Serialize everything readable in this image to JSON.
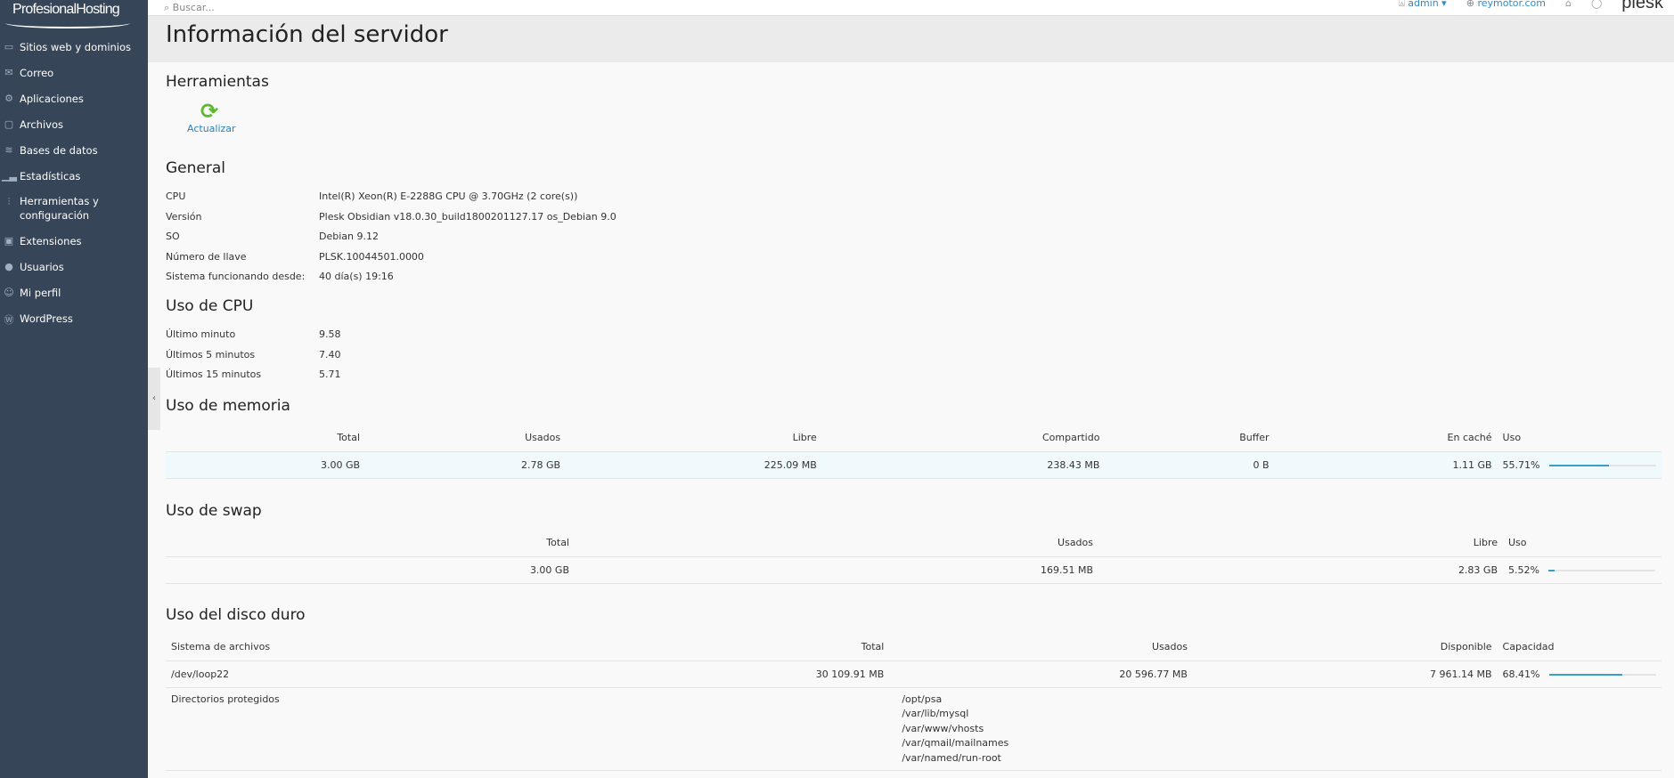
{
  "brand": "ProfesionalHosting",
  "sidebar": {
    "items": [
      {
        "label": "Sitios web y dominios",
        "icon": "monitor-icon"
      },
      {
        "label": "Correo",
        "icon": "mail-icon"
      },
      {
        "label": "Aplicaciones",
        "icon": "gear-icon"
      },
      {
        "label": "Archivos",
        "icon": "folder-icon"
      },
      {
        "label": "Bases de datos",
        "icon": "database-icon"
      },
      {
        "label": "Estadísticas",
        "icon": "bar-chart-icon"
      },
      {
        "label": "Herramientas y configuración",
        "icon": "sliders-icon"
      },
      {
        "label": "Extensiones",
        "icon": "extensions-icon"
      },
      {
        "label": "Usuarios",
        "icon": "user-icon"
      },
      {
        "label": "Mi perfil",
        "icon": "profile-icon"
      },
      {
        "label": "WordPress",
        "icon": "wordpress-icon"
      }
    ]
  },
  "topbar": {
    "search_placeholder": "Buscar...",
    "user": "admin",
    "subscription": "reymotor.com",
    "logo": "plesk"
  },
  "page_title": "Información del servidor",
  "tools": {
    "heading": "Herramientas",
    "refresh_label": "Actualizar"
  },
  "general": {
    "heading": "General",
    "rows": [
      {
        "k": "CPU",
        "v": "Intel(R) Xeon(R) E-2288G CPU @ 3.70GHz (2 core(s))"
      },
      {
        "k": "Versión",
        "v": "Plesk Obsidian v18.0.30_build1800201127.17 os_Debian 9.0"
      },
      {
        "k": "SO",
        "v": "Debian 9.12"
      },
      {
        "k": "Número de llave",
        "v": "PLSK.10044501.0000"
      },
      {
        "k": "Sistema funcionando desde:",
        "v": "40 día(s) 19:16"
      }
    ]
  },
  "cpu": {
    "heading": "Uso de CPU",
    "rows": [
      {
        "k": "Último minuto",
        "v": "9.58"
      },
      {
        "k": "Últimos 5 minutos",
        "v": "7.40"
      },
      {
        "k": "Últimos 15 minutos",
        "v": "5.71"
      }
    ]
  },
  "memory": {
    "heading": "Uso de memoria",
    "headers": [
      "Total",
      "Usados",
      "Libre",
      "Compartido",
      "Buffer",
      "En caché",
      "Uso"
    ],
    "values": [
      "3.00 GB",
      "2.78 GB",
      "225.09 MB",
      "238.43 MB",
      "0 B",
      "1.11 GB",
      "55.71%"
    ],
    "usage_percent": 55.71
  },
  "swap": {
    "heading": "Uso de swap",
    "headers": [
      "Total",
      "Usados",
      "Libre",
      "Uso"
    ],
    "values": [
      "3.00 GB",
      "169.51 MB",
      "2.83 GB",
      "5.52%"
    ],
    "usage_percent": 5.52
  },
  "disk": {
    "heading": "Uso del disco duro",
    "headers": [
      "Sistema de archivos",
      "Total",
      "Usados",
      "Disponible",
      "Capacidad"
    ],
    "values": [
      "/dev/loop22",
      "30 109.91 MB",
      "20 596.77 MB",
      "7 961.14 MB",
      "68.41%"
    ],
    "usage_percent": 68.41,
    "protected_label": "Directorios protegidos",
    "protected_dirs": [
      "/opt/psa",
      "/var/lib/mysql",
      "/var/www/vhosts",
      "/var/qmail/mailnames",
      "/var/named/run-root"
    ]
  },
  "colors": {
    "sidebar": "#364557",
    "accent": "#3a9fc8",
    "refresh": "#5cb82e",
    "link": "#2c7fb8"
  }
}
